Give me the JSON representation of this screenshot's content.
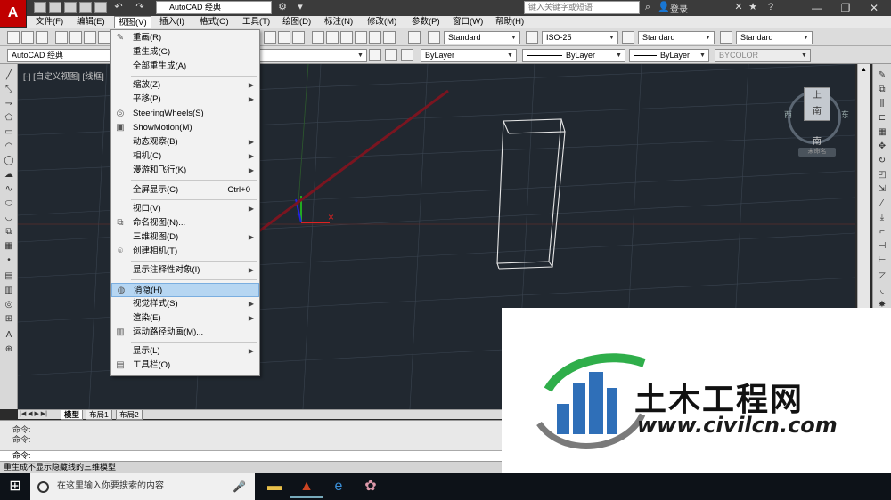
{
  "window": {
    "workspace": "AutoCAD 经典",
    "search_placeholder": "键入关键字或短语",
    "login": "登录"
  },
  "menubar": [
    {
      "label": "文件(F)"
    },
    {
      "label": "编辑(E)"
    },
    {
      "label": "视图(V)"
    },
    {
      "label": "插入(I)"
    },
    {
      "label": "格式(O)"
    },
    {
      "label": "工具(T)"
    },
    {
      "label": "绘图(D)"
    },
    {
      "label": "标注(N)"
    },
    {
      "label": "修改(M)"
    },
    {
      "label": "参数(P)"
    },
    {
      "label": "窗口(W)"
    },
    {
      "label": "帮助(H)"
    }
  ],
  "toolbar": {
    "text_style": "Standard",
    "dim_style": "ISO-25",
    "table_style": "Standard",
    "mleader_style": "Standard",
    "workspace2": "AutoCAD 经典",
    "layer_color": "ByLayer",
    "linetype": "ByLayer",
    "lineweight": "ByLayer",
    "plotstyle": "BYCOLOR"
  },
  "view_menu": {
    "items": [
      {
        "label": "重画(R)",
        "icon": "pencil-icon",
        "arrow": false,
        "shortcut": ""
      },
      {
        "label": "重生成(G)",
        "icon": "",
        "arrow": false,
        "shortcut": ""
      },
      {
        "label": "全部重生成(A)",
        "icon": "",
        "arrow": false,
        "shortcut": ""
      },
      {
        "label": "缩放(Z)",
        "icon": "",
        "arrow": true,
        "shortcut": ""
      },
      {
        "label": "平移(P)",
        "icon": "",
        "arrow": true,
        "shortcut": ""
      },
      {
        "label": "SteeringWheels(S)",
        "icon": "wheel-icon",
        "arrow": false,
        "shortcut": ""
      },
      {
        "label": "ShowMotion(M)",
        "icon": "film-icon",
        "arrow": false,
        "shortcut": ""
      },
      {
        "label": "动态观察(B)",
        "icon": "",
        "arrow": true,
        "shortcut": ""
      },
      {
        "label": "相机(C)",
        "icon": "",
        "arrow": true,
        "shortcut": ""
      },
      {
        "label": "漫游和飞行(K)",
        "icon": "",
        "arrow": true,
        "shortcut": ""
      },
      {
        "label": "全屏显示(C)",
        "icon": "",
        "arrow": false,
        "shortcut": "Ctrl+0"
      },
      {
        "label": "视口(V)",
        "icon": "",
        "arrow": true,
        "shortcut": ""
      },
      {
        "label": "命名视图(N)...",
        "icon": "named-view-icon",
        "arrow": false,
        "shortcut": ""
      },
      {
        "label": "三维视图(D)",
        "icon": "",
        "arrow": true,
        "shortcut": ""
      },
      {
        "label": "创建相机(T)",
        "icon": "camera-icon",
        "arrow": false,
        "shortcut": ""
      },
      {
        "label": "显示注释性对象(I)",
        "icon": "",
        "arrow": true,
        "shortcut": ""
      },
      {
        "label": "消隐(H)",
        "icon": "hide-icon",
        "arrow": false,
        "shortcut": "",
        "selected": true
      },
      {
        "label": "视觉样式(S)",
        "icon": "",
        "arrow": true,
        "shortcut": ""
      },
      {
        "label": "渲染(E)",
        "icon": "",
        "arrow": true,
        "shortcut": ""
      },
      {
        "label": "运动路径动画(M)...",
        "icon": "motion-path-icon",
        "arrow": false,
        "shortcut": ""
      },
      {
        "label": "显示(L)",
        "icon": "",
        "arrow": true,
        "shortcut": ""
      },
      {
        "label": "工具栏(O)...",
        "icon": "toolbar-icon",
        "arrow": false,
        "shortcut": ""
      }
    ]
  },
  "viewport": {
    "label": "[-] [自定义视图] [线框]",
    "viewcube_top": "上",
    "viewcube_front": "南",
    "viewcube_west": "西",
    "viewcube_east": "东",
    "viewcube_south": "南",
    "wcs": "未命名"
  },
  "layout_tabs": [
    {
      "label": "模型",
      "active": true
    },
    {
      "label": "布局1",
      "active": false
    },
    {
      "label": "布局2",
      "active": false
    }
  ],
  "command": {
    "history": [
      "命令:",
      "命令:"
    ],
    "prompt": "命令:"
  },
  "status_text": "重生成不显示隐藏线的三维模型",
  "taskbar": {
    "search_placeholder": "在这里输入你要搜索的内容"
  },
  "watermark": {
    "cn": "土木工程网",
    "url": "www.civilcn.com"
  },
  "colors": {
    "viewport_bg": "#212830",
    "arrow": "#7a1520",
    "menu_highlight": "#b6d6f2"
  }
}
